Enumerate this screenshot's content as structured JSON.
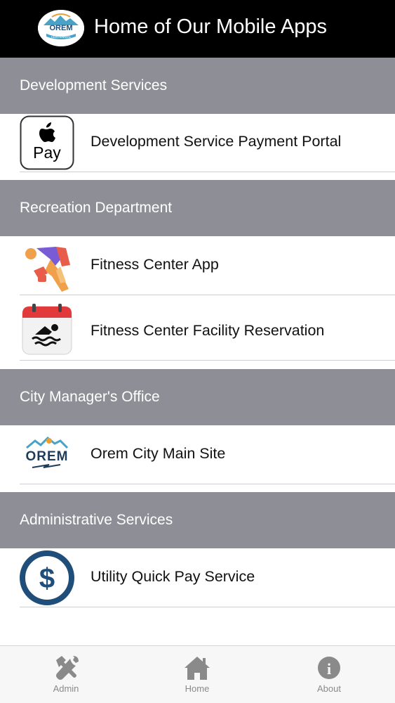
{
  "header": {
    "title": "Home of Our Mobile Apps",
    "logo_text": "OREM",
    "logo_subtext": "CENTENNIAL"
  },
  "sections": [
    {
      "title": "Development Services",
      "items": [
        {
          "label": "Development Service Payment Portal",
          "icon": "apple-pay-icon",
          "icon_text": "Pay"
        }
      ]
    },
    {
      "title": "Recreation Department",
      "items": [
        {
          "label": "Fitness Center App",
          "icon": "fitness-icon"
        },
        {
          "label": "Fitness Center Facility Reservation",
          "icon": "swim-calendar-icon"
        }
      ]
    },
    {
      "title": "City Manager's Office",
      "items": [
        {
          "label": "Orem City Main Site",
          "icon": "orem-logo-icon",
          "icon_text": "OREM"
        }
      ]
    },
    {
      "title": "Administrative Services",
      "items": [
        {
          "label": "Utility Quick Pay Service",
          "icon": "dollar-icon",
          "icon_text": "$"
        }
      ]
    }
  ],
  "tabbar": {
    "items": [
      {
        "label": "Admin",
        "icon": "tools-icon"
      },
      {
        "label": "Home",
        "icon": "home-icon"
      },
      {
        "label": "About",
        "icon": "info-icon",
        "icon_text": "i"
      }
    ]
  },
  "colors": {
    "header_bg": "#000000",
    "section_bg": "#8e8f96",
    "tab_icon": "#8a8a8a",
    "dollar_blue": "#1f4e7a"
  }
}
